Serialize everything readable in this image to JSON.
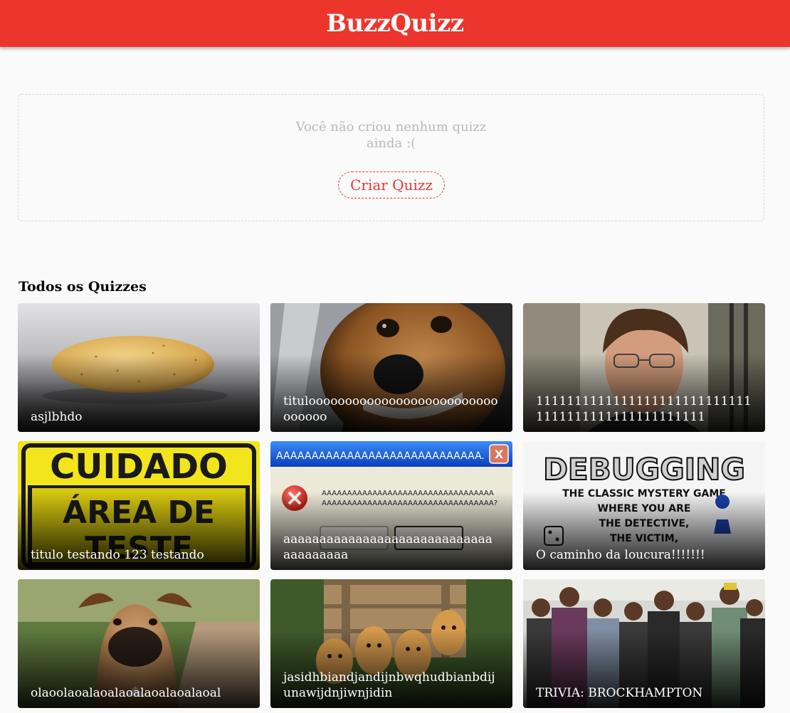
{
  "header": {
    "title": "BuzzQuizz"
  },
  "my_quizzes": {
    "empty_line1": "Você não criou nenhum quizz",
    "empty_line2": "ainda :(",
    "create_button": "Criar Quizz"
  },
  "all_quizzes": {
    "title": "Todos os Quizzes",
    "items": [
      {
        "title": "asjlbhdo",
        "image": "potato-image"
      },
      {
        "title": "tituloooooooooooooooooooooooooooooooo",
        "image": "dog-closeup-image"
      },
      {
        "title": "11111111111111111111111111111111111111111111111111",
        "image": "man-portrait-image"
      },
      {
        "title": "titulo testando 123 testando",
        "image": "caution-sign-image"
      },
      {
        "title": "aaaaaaaaaaaaaaaaaaaaaaaaaaaaaaaaaaaaaa",
        "image": "error-dialog-image"
      },
      {
        "title": "O caminho da loucura!!!!!!!",
        "image": "debugging-poster-image"
      },
      {
        "title": "olaoolaoalaoalaoalaoalaoalaoal",
        "image": "boxer-dog-image"
      },
      {
        "title": "jasidhbiandjandijnbwqhudbianbdijunawijdnjiwnjidin",
        "image": "puppies-image"
      },
      {
        "title": "TRIVIA: BROCKHAMPTON",
        "image": "group-photo-image"
      }
    ]
  },
  "colors": {
    "brand": "#ec362d",
    "background": "#fafafa",
    "muted_text": "#b9b9b9"
  }
}
